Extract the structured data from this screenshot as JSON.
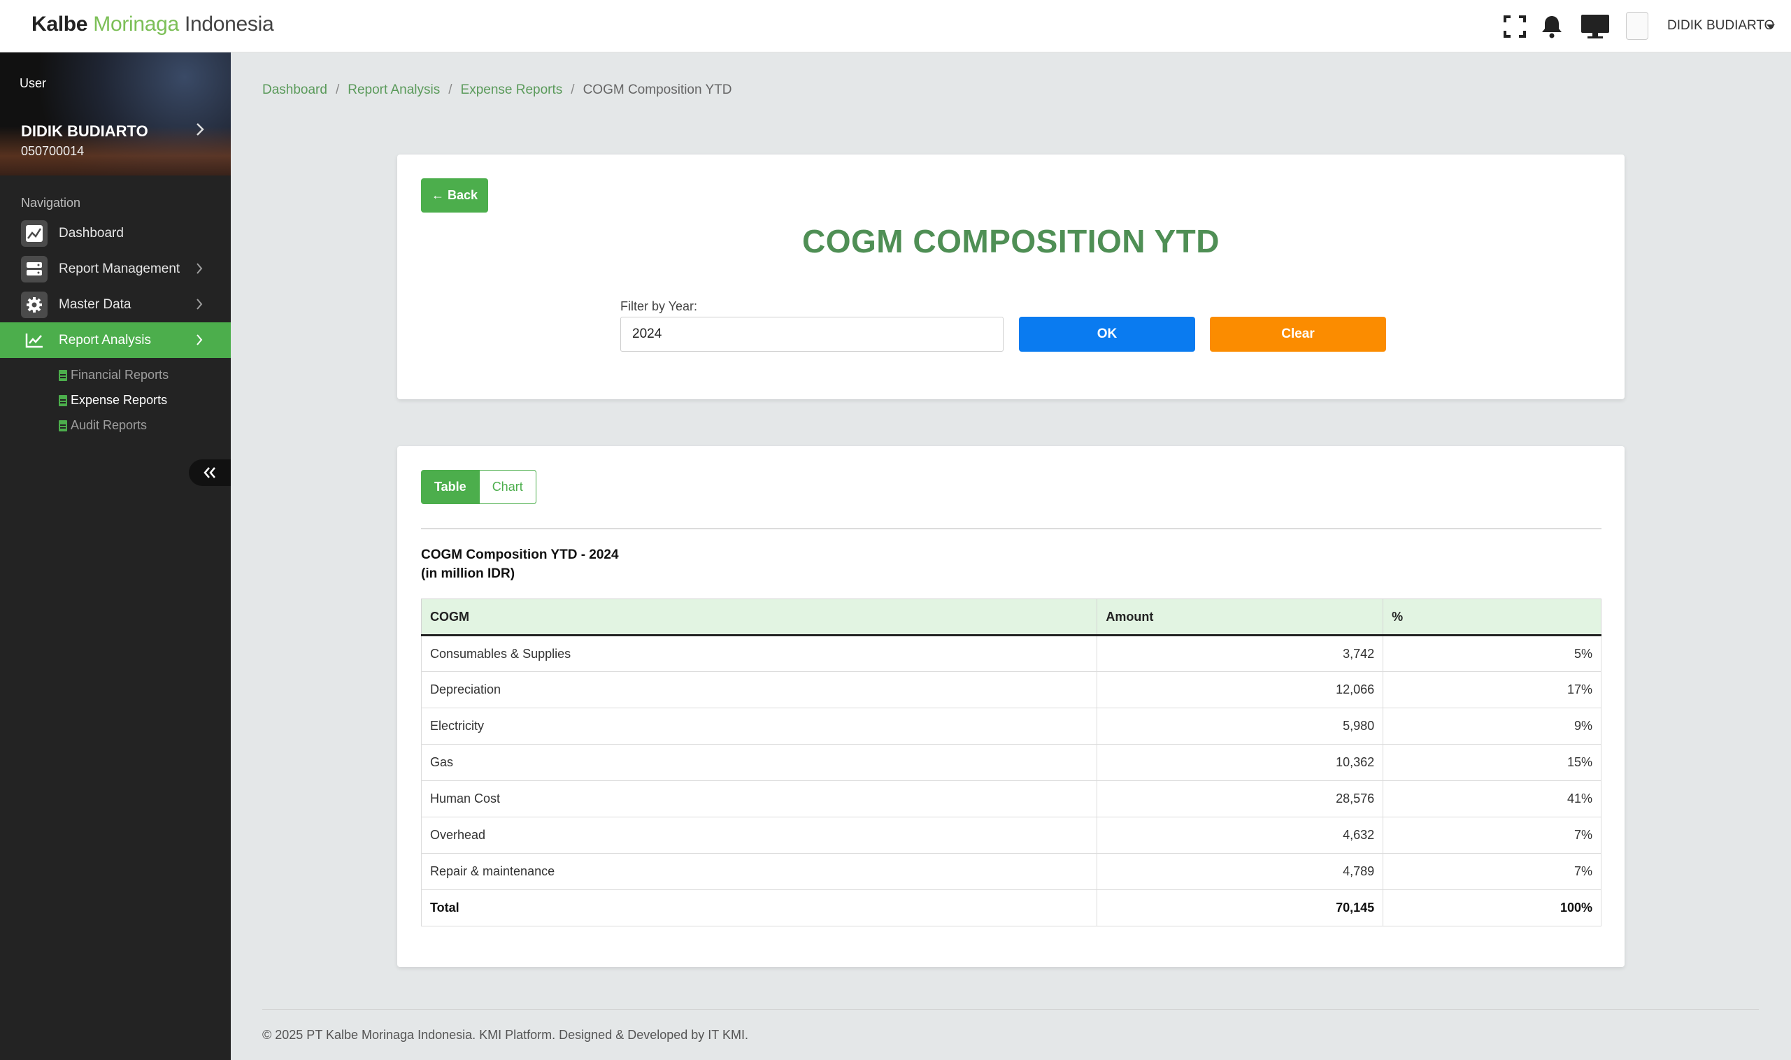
{
  "header": {
    "logo": {
      "part1": "Kalbe",
      "part2": "Morinaga",
      "part3": "Indonesia"
    },
    "user_name": "DIDIK BUDIARTO",
    "icons": [
      "fullscreen-icon",
      "bell-icon",
      "monitor-icon",
      "avatar"
    ]
  },
  "sidebar": {
    "profile": {
      "image_alt": "User",
      "name": "DIDIK BUDIARTO",
      "id": "050700014"
    },
    "nav_heading": "Navigation",
    "items": [
      {
        "label": "Dashboard",
        "icon": "chart-icon"
      },
      {
        "label": "Report Management",
        "icon": "server-icon"
      },
      {
        "label": "Master Data",
        "icon": "gear-icon"
      },
      {
        "label": "Report Analysis",
        "icon": "line-chart-icon",
        "active": true
      }
    ],
    "subitems": [
      {
        "label": "Financial Reports"
      },
      {
        "label": "Expense Reports",
        "current": true
      },
      {
        "label": "Audit Reports"
      }
    ]
  },
  "breadcrumb": {
    "items": [
      "Dashboard",
      "Report Analysis",
      "Expense Reports"
    ],
    "current": "COGM Composition YTD"
  },
  "filter_card": {
    "back_label": "← Back",
    "title": "COGM COMPOSITION YTD",
    "filter_label": "Filter by Year:",
    "year_value": "2024",
    "ok_label": "OK",
    "clear_label": "Clear"
  },
  "table_card": {
    "tabs": [
      {
        "label": "Table",
        "active": true
      },
      {
        "label": "Chart",
        "active": false
      }
    ],
    "title_line1": "COGM Composition YTD - 2024",
    "title_line2": "(in million IDR)",
    "columns": [
      "COGM",
      "Amount",
      "%"
    ],
    "rows": [
      [
        "Consumables & Supplies",
        "3,742",
        "5%"
      ],
      [
        "Depreciation",
        "12,066",
        "17%"
      ],
      [
        "Electricity",
        "5,980",
        "9%"
      ],
      [
        "Gas",
        "10,362",
        "15%"
      ],
      [
        "Human Cost",
        "28,576",
        "41%"
      ],
      [
        "Overhead",
        "4,632",
        "7%"
      ],
      [
        "Repair & maintenance",
        "4,789",
        "7%"
      ]
    ],
    "total": [
      "Total",
      "70,145",
      "100%"
    ]
  },
  "footer": {
    "text": "© 2025 PT Kalbe Morinaga Indonesia. KMI Platform. Designed & Developed by IT KMI."
  },
  "colors": {
    "accent_green": "#4cae4c",
    "title_green": "#4f8f55",
    "ok_blue": "#0a7bf0",
    "clear_orange": "#fb8c00",
    "sidebar_bg": "#232323"
  }
}
